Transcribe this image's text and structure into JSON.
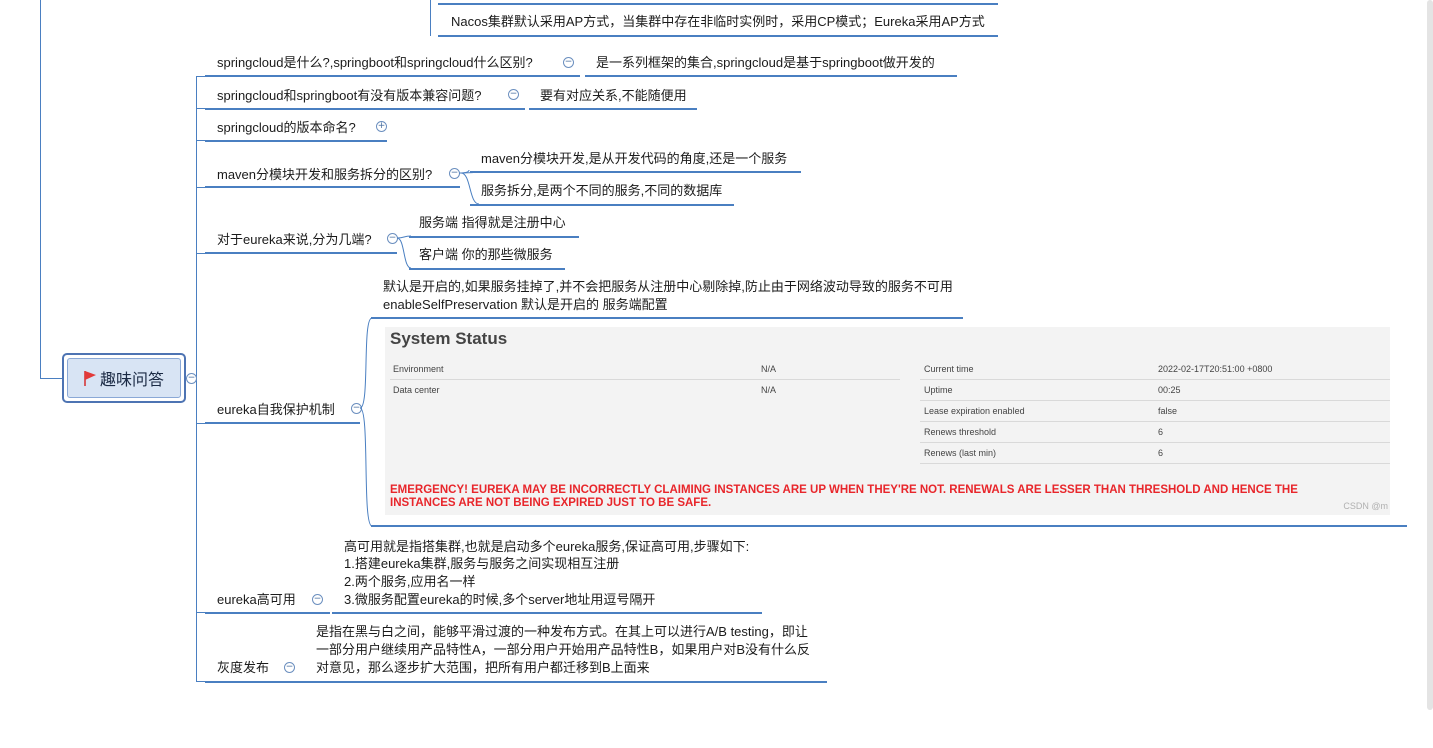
{
  "root": {
    "label": "趣味问答"
  },
  "top_note": "Nacos集群默认采用AP方式，当集群中存在非临时实例时，采用CP模式；Eureka采用AP方式",
  "topics": [
    {
      "label": "springcloud是什么?,springboot和springcloud什么区别?",
      "answers": [
        "是一系列框架的集合,springcloud是基于springboot做开发的"
      ]
    },
    {
      "label": "springcloud和springboot有没有版本兼容问题?",
      "answers": [
        "要有对应关系,不能随便用"
      ]
    },
    {
      "label": "springcloud的版本命名?",
      "answers": []
    },
    {
      "label": "maven分模块开发和服务拆分的区别?",
      "answers": [
        "maven分模块开发,是从开发代码的角度,还是一个服务",
        "服务拆分,是两个不同的服务,不同的数据库"
      ]
    },
    {
      "label": "对于eureka来说,分为几端?",
      "answers": [
        "服务端 指得就是注册中心",
        "客户端 你的那些微服务"
      ]
    },
    {
      "label": "eureka自我保护机制",
      "answers": [
        "默认是开启的,如果服务挂掉了,并不会把服务从注册中心剔除掉,防止由于网络波动导致的服务不可用",
        "enableSelfPreservation 默认是开启的 服务端配置"
      ]
    },
    {
      "label": "eureka高可用",
      "answers": [
        "高可用就是指搭集群,也就是启动多个eureka服务,保证高可用,步骤如下:",
        "1.搭建eureka集群,服务与服务之间实现相互注册",
        "2.两个服务,应用名一样",
        "3.微服务配置eureka的时候,多个server地址用逗号隔开"
      ]
    },
    {
      "label": "灰度发布",
      "answers": [
        "是指在黑与白之间，能够平滑过渡的一种发布方式。在其上可以进行A/B testing，即让",
        "一部分用户继续用产品特性A，一部分用户开始用产品特性B，如果用户对B没有什么反",
        "对意见，那么逐步扩大范围，把所有用户都迁移到B上面来"
      ]
    }
  ],
  "status_panel": {
    "title": "System Status",
    "left_rows": [
      {
        "key": "Environment",
        "value": "N/A"
      },
      {
        "key": "Data center",
        "value": "N/A"
      }
    ],
    "right_rows": [
      {
        "key": "Current time",
        "value": "2022-02-17T20:51:00 +0800"
      },
      {
        "key": "Uptime",
        "value": "00:25"
      },
      {
        "key": "Lease expiration enabled",
        "value": "false"
      },
      {
        "key": "Renews threshold",
        "value": "6"
      },
      {
        "key": "Renews (last min)",
        "value": "6"
      }
    ],
    "emergency_line1": "EMERGENCY! EUREKA MAY BE INCORRECTLY CLAIMING INSTANCES ARE UP WHEN THEY'RE NOT. RENEWALS ARE LESSER THAN THRESHOLD AND HENCE THE",
    "emergency_line2": "INSTANCES ARE NOT BEING EXPIRED JUST TO BE SAFE.",
    "watermark": "CSDN @m"
  },
  "colors": {
    "line": "#4a7fc1",
    "emergency": "#e8262b",
    "root_fill": "#d8e4f4"
  }
}
